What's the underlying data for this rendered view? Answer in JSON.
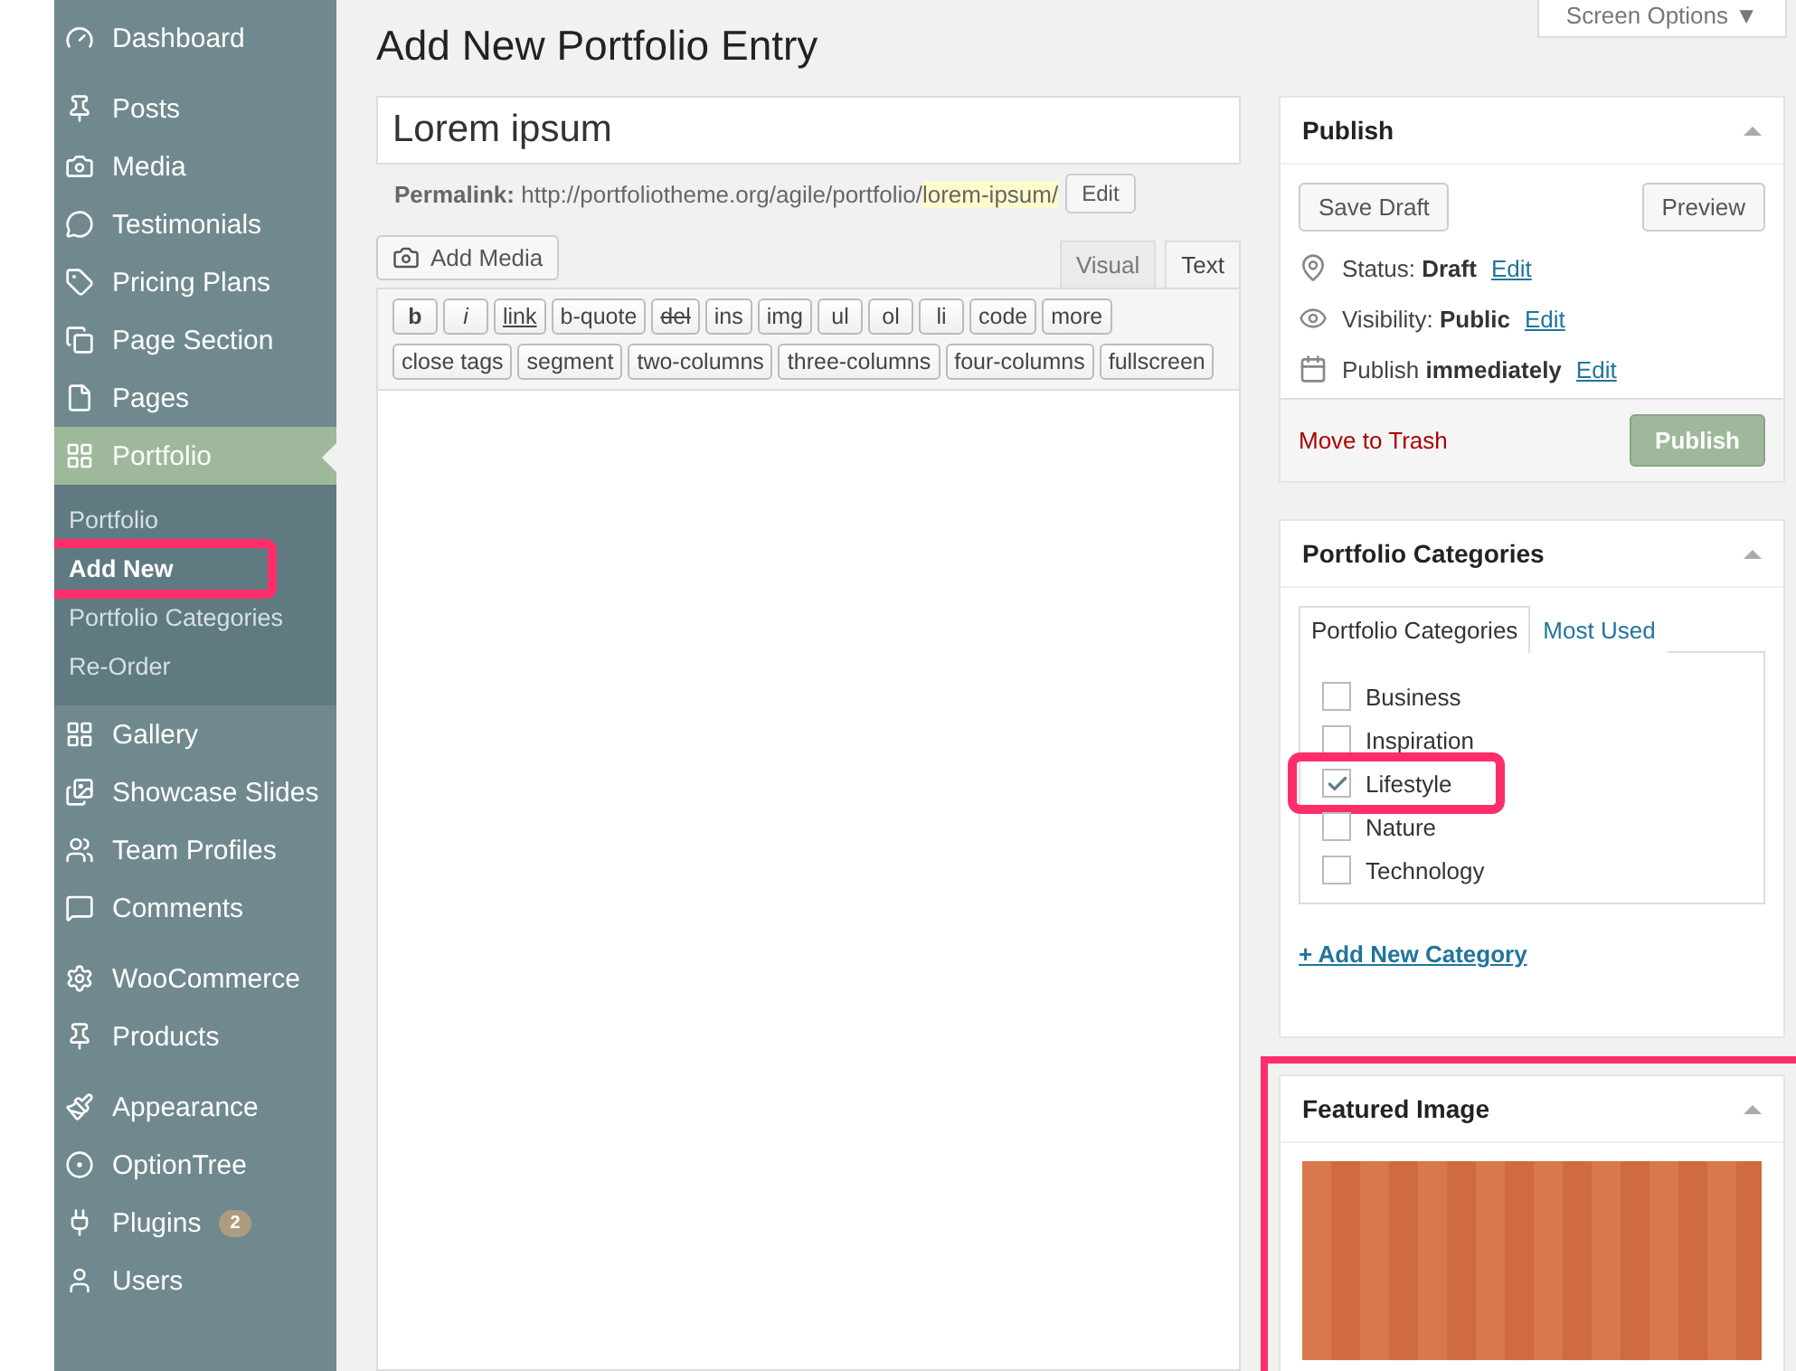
{
  "sidebar": {
    "groups": [
      {
        "items": [
          {
            "label": "Dashboard",
            "selected": false
          }
        ]
      },
      {
        "items": [
          {
            "label": "Posts",
            "selected": false
          },
          {
            "label": "Media",
            "selected": false
          },
          {
            "label": "Testimonials",
            "selected": false
          },
          {
            "label": "Pricing Plans",
            "selected": false
          },
          {
            "label": "Page Section",
            "selected": false
          },
          {
            "label": "Pages",
            "selected": false
          },
          {
            "label": "Portfolio",
            "selected": true,
            "children": [
              {
                "label": "Portfolio",
                "selected": false,
                "highlighted": false
              },
              {
                "label": "Add New",
                "selected": true,
                "highlighted": true
              },
              {
                "label": "Portfolio Categories",
                "selected": false,
                "highlighted": false
              },
              {
                "label": "Re-Order",
                "selected": false,
                "highlighted": false
              }
            ]
          },
          {
            "label": "Gallery",
            "selected": false
          },
          {
            "label": "Showcase Slides",
            "selected": false
          },
          {
            "label": "Team Profiles",
            "selected": false
          },
          {
            "label": "Comments",
            "selected": false
          }
        ]
      },
      {
        "items": [
          {
            "label": "WooCommerce",
            "selected": false
          },
          {
            "label": "Products",
            "selected": false
          }
        ]
      },
      {
        "items": [
          {
            "label": "Appearance",
            "selected": false
          },
          {
            "label": "OptionTree",
            "selected": false
          },
          {
            "label": "Plugins",
            "selected": false,
            "badge": "2"
          },
          {
            "label": "Users",
            "selected": false
          }
        ]
      }
    ]
  },
  "page": {
    "title": "Add New Portfolio Entry",
    "screen_options": "Screen Options ▼"
  },
  "editor": {
    "title_value": "Lorem ipsum",
    "permalink_label": "Permalink:",
    "permalink_base": "http://portfoliotheme.org/agile/portfolio/",
    "permalink_slug": "lorem-ipsum/",
    "permalink_edit": "Edit",
    "add_media": "Add Media",
    "tabs": [
      {
        "label": "Visual",
        "selected": false
      },
      {
        "label": "Text",
        "selected": true
      }
    ],
    "quicktags": [
      [
        "b",
        "i",
        "link",
        "b-quote",
        "del",
        "ins",
        "img",
        "ul",
        "ol",
        "li",
        "code",
        "more"
      ],
      [
        "close tags",
        "segment",
        "two-columns",
        "three-columns",
        "four-columns",
        "fullscreen"
      ]
    ]
  },
  "publish": {
    "title": "Publish",
    "save_draft": "Save Draft",
    "preview": "Preview",
    "rows": [
      {
        "label": "Status:",
        "value": "Draft",
        "link": "Edit"
      },
      {
        "label": "Visibility:",
        "value": "Public",
        "link": "Edit"
      },
      {
        "label": "Publish",
        "value": "immediately",
        "link": "Edit"
      }
    ],
    "trash": "Move to Trash",
    "publish": "Publish"
  },
  "categories": {
    "title": "Portfolio Categories",
    "tabs": [
      {
        "label": "Portfolio Categories",
        "selected": true
      },
      {
        "label": "Most Used",
        "selected": false
      }
    ],
    "items": [
      {
        "label": "Business",
        "checked": false,
        "highlighted": false
      },
      {
        "label": "Inspiration",
        "checked": false,
        "highlighted": false
      },
      {
        "label": "Lifestyle",
        "checked": true,
        "highlighted": true
      },
      {
        "label": "Nature",
        "checked": false,
        "highlighted": false
      },
      {
        "label": "Technology",
        "checked": false,
        "highlighted": false
      }
    ],
    "add_new": "+ Add New Category"
  },
  "featured": {
    "title": "Featured Image",
    "highlighted": true
  }
}
